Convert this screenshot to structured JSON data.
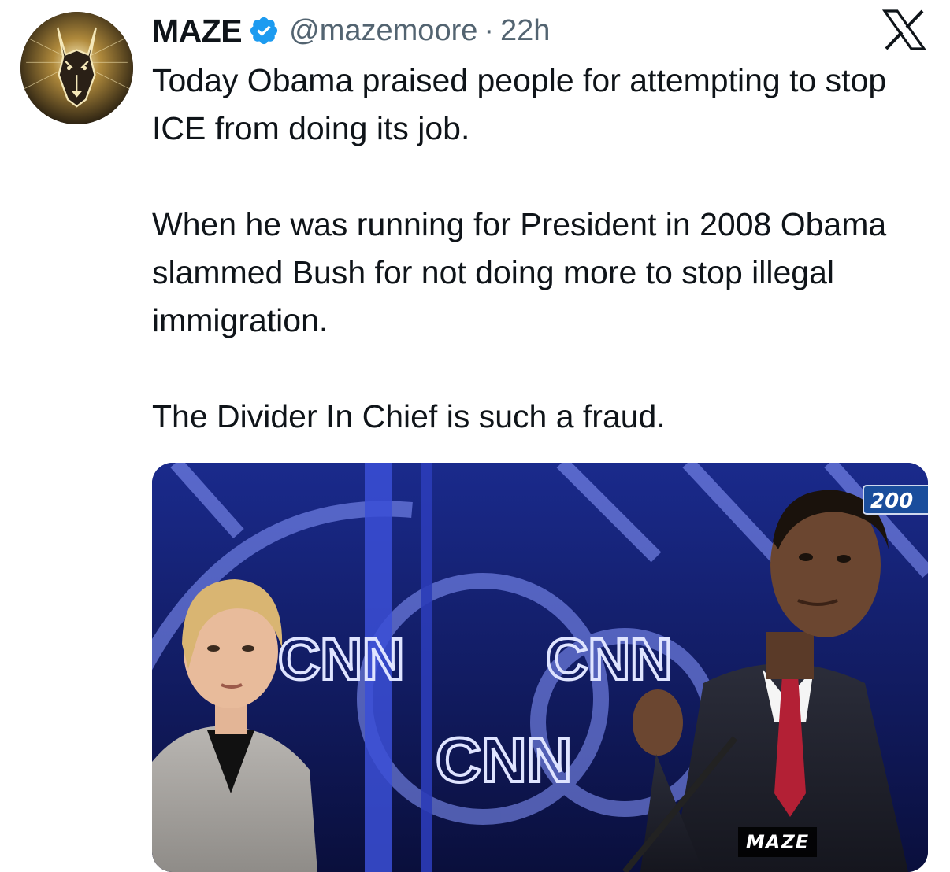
{
  "tweet": {
    "author": {
      "display_name": "MAZE",
      "handle": "@mazemoore",
      "verified": true,
      "avatar_icon": "doberman-logo-icon"
    },
    "separator": "·",
    "timestamp": "22h",
    "paragraphs": [
      "Today Obama praised people for attempting to stop ICE from doing its job.",
      "When he was running for President in 2008 Obama slammed Bush for not doing more to stop illegal immigration.",
      "The Divider In Chief is such a fraud."
    ],
    "media": {
      "type": "video-still",
      "year_badge": "200",
      "watermark": "MAZE",
      "backdrop_text": [
        "CNN",
        "CNN",
        "CNN"
      ]
    }
  },
  "platform": {
    "logo_icon": "x-logo-icon"
  },
  "colors": {
    "text_primary": "#0f1419",
    "text_secondary": "#536471",
    "verified_blue": "#1d9bf0",
    "media_backdrop": "#0b1248"
  }
}
